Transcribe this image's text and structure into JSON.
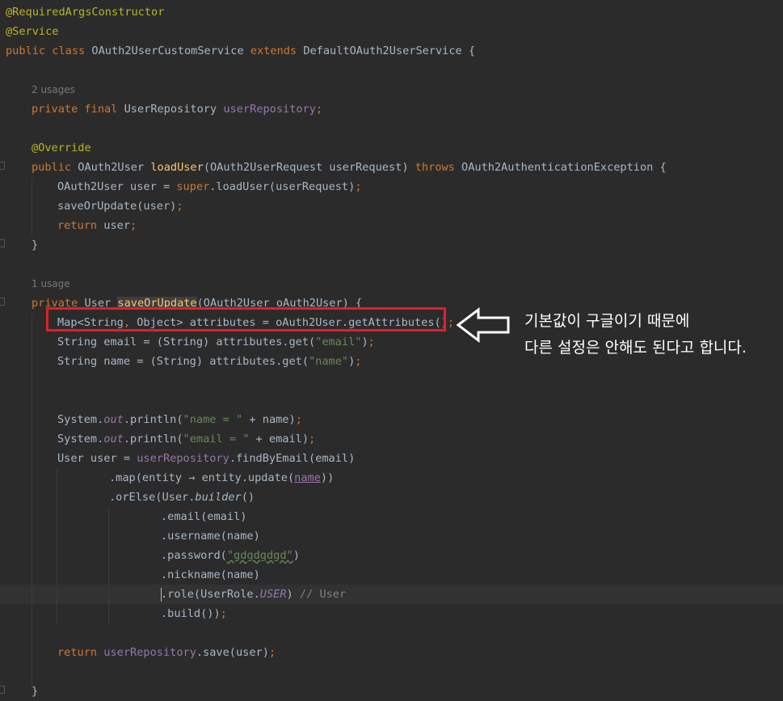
{
  "editor": {
    "lines": {
      "l1": "@RequiredArgsConstructor",
      "l2": "@Service",
      "l3a": "public class ",
      "l3b": "OAuth2UserCustomService ",
      "l3c": "extends ",
      "l3d": "DefaultOAuth2UserService {",
      "usage1": "2 usages",
      "l5a": "private final ",
      "l5b": "UserRepository ",
      "l5c": "userRepository",
      "l5d": ";",
      "l7": "@Override",
      "l8a": "public ",
      "l8b": "OAuth2User ",
      "l8c": "loadUser",
      "l8d": "(OAuth2UserRequest userRequest) ",
      "l8e": "throws ",
      "l8f": "OAuth2AuthenticationException {",
      "l9a": "OAuth2User user = ",
      "l9b": "super",
      "l9c": ".loadUser(userRequest)",
      "l9d": ";",
      "l10a": "saveOrUpdate(user)",
      "l10b": ";",
      "l11a": "return ",
      "l11b": "user",
      "l11c": ";",
      "l12": "}",
      "usage2": "1 usage",
      "l14a": "private ",
      "l14b": "User ",
      "l14c": "saveOrUpdate",
      "l14d": "(OAuth2User oAuth2User) {",
      "l15a": "Map<String",
      "l15b": ", ",
      "l15c": "Object> attributes = oAuth2User.getAttributes()",
      "l15d": ";",
      "l16a": "String email = (String) attributes.get(",
      "l16b": "\"email\"",
      "l16c": ")",
      "l16d": ";",
      "l17a": "String name = (String) attributes.get(",
      "l17b": "\"name\"",
      "l17c": ")",
      "l17d": ";",
      "l20a": "System.",
      "l20b": "out",
      "l20c": ".println(",
      "l20d": "\"name = \"",
      "l20e": " + name)",
      "l20f": ";",
      "l21a": "System.",
      "l21b": "out",
      "l21c": ".println(",
      "l21d": "\"email = \"",
      "l21e": " + email)",
      "l21f": ";",
      "l22a": "User user = ",
      "l22b": "userRepository",
      "l22c": ".findByEmail(email)",
      "l23a": ".map(entity ",
      "l23b": "→",
      "l23c": " entity.update(",
      "l23d": "name",
      "l23e": "))",
      "l24a": ".orElse(User.",
      "l24b": "builder",
      "l24c": "()",
      "l25": ".email(email)",
      "l26": ".username(name)",
      "l27a": ".password(",
      "l27b": "\"gdgdgdgd\"",
      "l27c": ")",
      "l28": ".nickname(name)",
      "l29a": ".role(UserRole.",
      "l29b": "USER",
      "l29c": ") ",
      "l29d": "// User",
      "l30a": ".build())",
      "l30b": ";",
      "l32a": "return ",
      "l32b": "userRepository",
      "l32c": ".save(user)",
      "l32d": ";",
      "l34": "}"
    }
  },
  "annotation": {
    "line1": "기본값이 구글이기 때문에",
    "line2": "다른 설정은 안해도 된다고 합니다.",
    "box_color": "#e0202a"
  },
  "icons": [
    "arrow-left-icon",
    "fold-marker-icon",
    "caret-icon"
  ]
}
